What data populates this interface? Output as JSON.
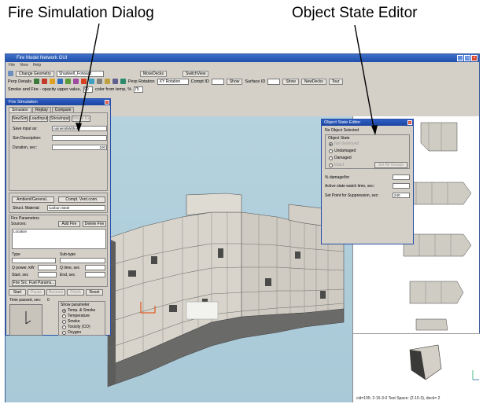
{
  "captions": {
    "left": "Fire Simulation Dialog",
    "right": "Object State Editor"
  },
  "window": {
    "title": "Fire Model Network GUI",
    "menu": [
      "File",
      "View",
      "Help"
    ]
  },
  "toolbar1": {
    "change_geometry": "Change Geometry",
    "geometry_value": "Shadwell_Forward",
    "move_decks": "MoveDecks",
    "switch_view": "SwitchView"
  },
  "toolbar2": {
    "perp_details": "Perp Details",
    "perp_rotation": "Perp Rotation",
    "rotation_value": "XY Rotation",
    "compt_id": "Compt ID",
    "show": "Show",
    "surface_id": "Surface ID",
    "show2": "Show",
    "new_decks": "NewDecks",
    "tour": "Tour"
  },
  "toolbar3": {
    "smoke_label": "Smoke and Fire - opacity upper value,",
    "smoke_value": "90",
    "color_label": "color from temp, %",
    "color_value": "75"
  },
  "fire_sim": {
    "title": "Fire Simulation",
    "tabs": [
      "Simulator",
      "Replay",
      "Compare"
    ],
    "buttons": {
      "new_sim": "NewSim",
      "load_input": "LoadInput",
      "show_input": "ShowInput",
      "merge_ex": "Merge Ex",
      "ambient": "Ambient/General...",
      "compt_vents": "Compt. Vent.conn.",
      "add_fire": "Add Fire",
      "delete_fire": "Delete Fire",
      "fire_src": "Fire Src. Fuel Params...",
      "start": "Start",
      "pause": "Pause",
      "resume": "Resume",
      "finish": "Finish",
      "reset": "Reset"
    },
    "save_input_label": "Save input as:",
    "save_input_value": "nameInitiWithoc",
    "sim_desc_label": "Sim Description:",
    "duration_label": "Duration, sec:",
    "duration_value": "100",
    "struct_material_label": "Struct. Material",
    "struct_material_value": "Carbon Steel",
    "fire_params_label": "Fire Parameters",
    "sources_label": "Sources:",
    "location_label": "Location",
    "type_label": "Type",
    "subtype_label": "Sub-type",
    "q_power_label": "Q power, kW",
    "q_time_label": "Q time, sec",
    "start_label": "Start, sec",
    "end_label": "End, sec",
    "time_passed_label": "Time passed, sec:",
    "time_passed_value": "0",
    "show_params_label": "Show parameter",
    "show_params": [
      "Temp. & Smoke",
      "Temperature",
      "Smoke",
      "Toxicity (CO)",
      "Oxygen"
    ],
    "show_params_selected": 0
  },
  "state_editor": {
    "title": "Object State Editor",
    "no_object": "No Object Selected",
    "object_state_label": "Object State",
    "states": [
      "Not destroyed",
      "Undamaged",
      "Damaged",
      "Intact"
    ],
    "set_all_button": "Set All Groups",
    "damage_label": "% damage/for",
    "active_state_label": "Active state watch time, sec:",
    "set_point_label": "Set Point for Suppression, sec:",
    "set_point_value": "240"
  },
  "status": {
    "text": "cid=105: 2-15-3-0 Test Space: (2-15-3), deck= 2"
  },
  "colors": {
    "titlebar": "#1f4fa8",
    "viewport_bg": "#aecbd9",
    "hull_light": "#d8d4cc",
    "hull_dark": "#6a6a68"
  }
}
